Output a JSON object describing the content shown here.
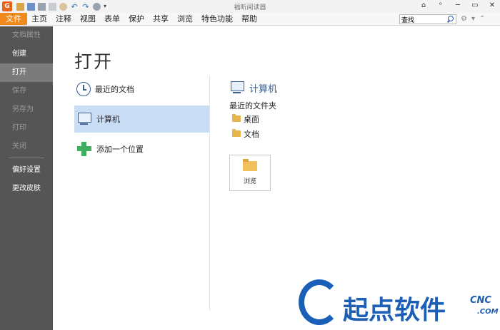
{
  "window": {
    "title": "福昕阅读器",
    "controls": [
      "⌂",
      "ᵒ",
      "─",
      "▭",
      "✕"
    ]
  },
  "app_logo": "G",
  "menu": {
    "items": [
      "文件",
      "主页",
      "注释",
      "视图",
      "表单",
      "保护",
      "共享",
      "浏览",
      "特色功能",
      "帮助"
    ],
    "active_index": 0
  },
  "search": {
    "value": "查找"
  },
  "sidebar": {
    "items": [
      {
        "label": "文档属性",
        "state": "disabled"
      },
      {
        "label": "创建",
        "state": "normal"
      },
      {
        "label": "打开",
        "state": "active"
      },
      {
        "label": "保存",
        "state": "disabled"
      },
      {
        "label": "另存为",
        "state": "disabled"
      },
      {
        "label": "打印",
        "state": "disabled"
      },
      {
        "label": "关闭",
        "state": "disabled"
      },
      {
        "label": "偏好设置",
        "state": "normal"
      },
      {
        "label": "更改皮肤",
        "state": "normal"
      }
    ]
  },
  "main": {
    "title": "打开",
    "locations": [
      {
        "label": "最近的文档",
        "icon": "clock-icon"
      },
      {
        "label": "计算机",
        "icon": "computer-icon",
        "selected": true
      },
      {
        "label": "添加一个位置",
        "icon": "plus-icon"
      }
    ],
    "right": {
      "heading": "计算机",
      "recent_folders_label": "最近的文件夹",
      "folders": [
        "桌面",
        "文档"
      ],
      "browse_label": "浏览"
    }
  },
  "watermark": {
    "text": "起点软件",
    "cn": "CNC",
    "com": ".COM"
  },
  "colors": {
    "accent": "#f08a1c",
    "sidebar": "#555555",
    "selection": "#c9ddf5",
    "brand_blue": "#3a5f93"
  }
}
